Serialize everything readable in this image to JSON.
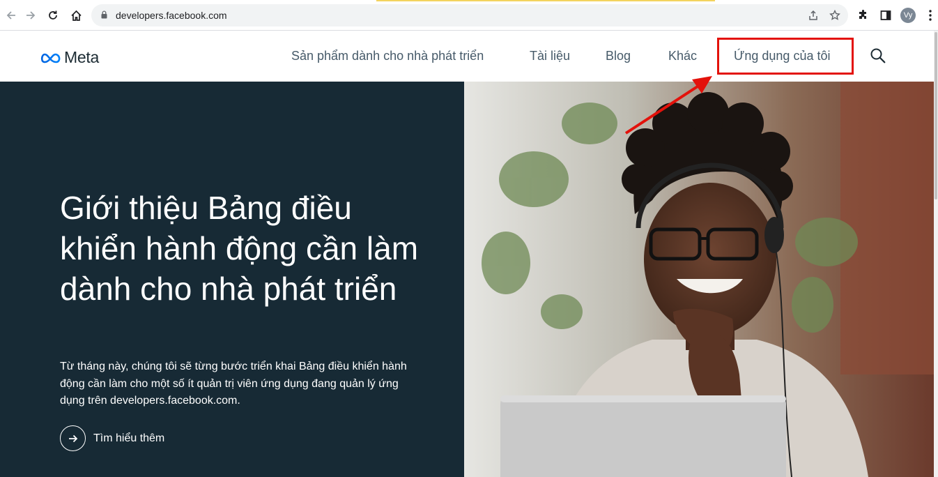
{
  "browser": {
    "url": "developers.facebook.com",
    "profile_initials": "Vy",
    "accent_color": "#f4d35e",
    "icons": [
      "back-icon",
      "forward-icon",
      "reload-icon",
      "home-icon",
      "lock-icon",
      "share-icon",
      "star-icon",
      "extensions-icon",
      "sidepanel-icon",
      "profile-avatar",
      "more-icon"
    ]
  },
  "header": {
    "logo_text": "Meta",
    "nav": [
      {
        "label": "Sản phẩm dành cho nhà phát triển"
      },
      {
        "label": "Tài liệu"
      },
      {
        "label": "Blog"
      },
      {
        "label": "Khác"
      },
      {
        "label": "Ứng dụng của tôi"
      }
    ],
    "highlight_color": "#e3120b"
  },
  "hero": {
    "title": "Giới thiệu Bảng điều khiển hành động cần làm dành cho nhà phát triển",
    "description": "Từ tháng này, chúng tôi sẽ từng bước triển khai Bảng điều khiển hành động cần làm cho một số ít quản trị viên ứng dụng đang quản lý ứng dụng trên developers.facebook.com.",
    "cta_label": "Tìm hiểu thêm",
    "background_color": "#172a35"
  },
  "annotation": {
    "arrow_color": "#e3120b"
  }
}
